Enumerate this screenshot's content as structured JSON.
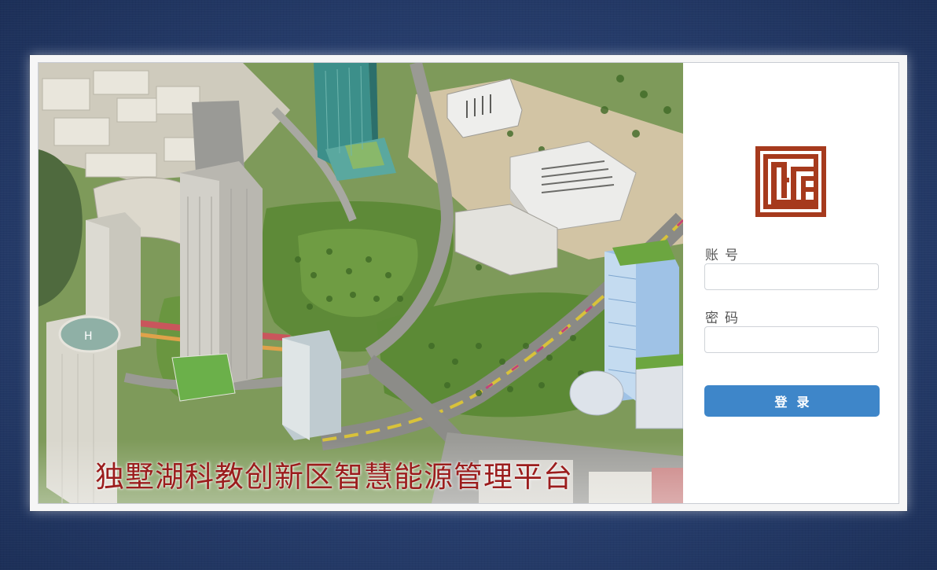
{
  "banner": {
    "title": "独墅湖科教创新区智慧能源管理平台",
    "title_color": "#9b1d1d"
  },
  "login": {
    "logo_icon": "seal-logo-icon",
    "logo_color": "#a63a1d",
    "account_label": "账号",
    "account_value": "",
    "password_label": "密码",
    "password_value": "",
    "submit_label": "登录",
    "button_color": "#3e86c9"
  },
  "colors": {
    "background": "#2a4273",
    "panel": "#ffffff"
  }
}
